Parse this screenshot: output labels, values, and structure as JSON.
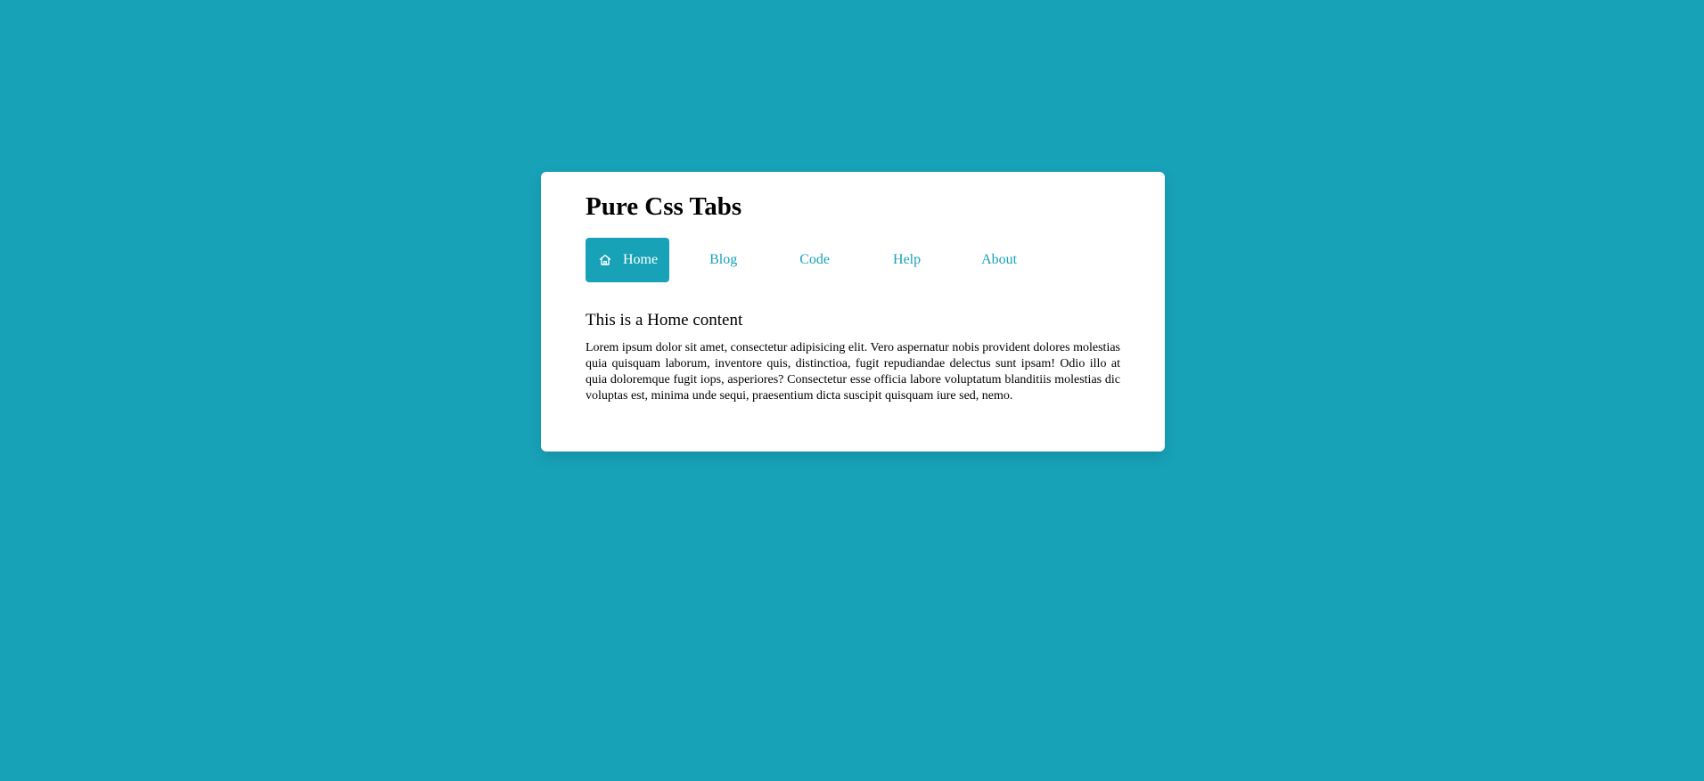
{
  "card": {
    "title": "Pure Css Tabs"
  },
  "tabs": [
    {
      "label": "Home",
      "icon": "home-icon",
      "active": true
    },
    {
      "label": "Blog",
      "active": false
    },
    {
      "label": "Code",
      "active": false
    },
    {
      "label": "Help",
      "active": false
    },
    {
      "label": "About",
      "active": false
    }
  ],
  "content": {
    "heading": "This is a Home content",
    "body": "Lorem ipsum dolor sit amet, consectetur adipisicing elit. Vero aspernatur nobis provident dolores molestias quia quisquam laborum, inventore quis, distinctioa, fugit repudiandae delectus sunt ipsam! Odio illo at quia doloremque fugit iops, asperiores? Consectetur esse officia labore voluptatum blanditiis molestias dic voluptas est, minima unde sequi, praesentium dicta suscipit quisquam iure sed, nemo."
  },
  "colors": {
    "background": "#18a2b8",
    "accent": "#18a2b8",
    "card": "#ffffff",
    "active_tab_text": "#ffffff"
  }
}
